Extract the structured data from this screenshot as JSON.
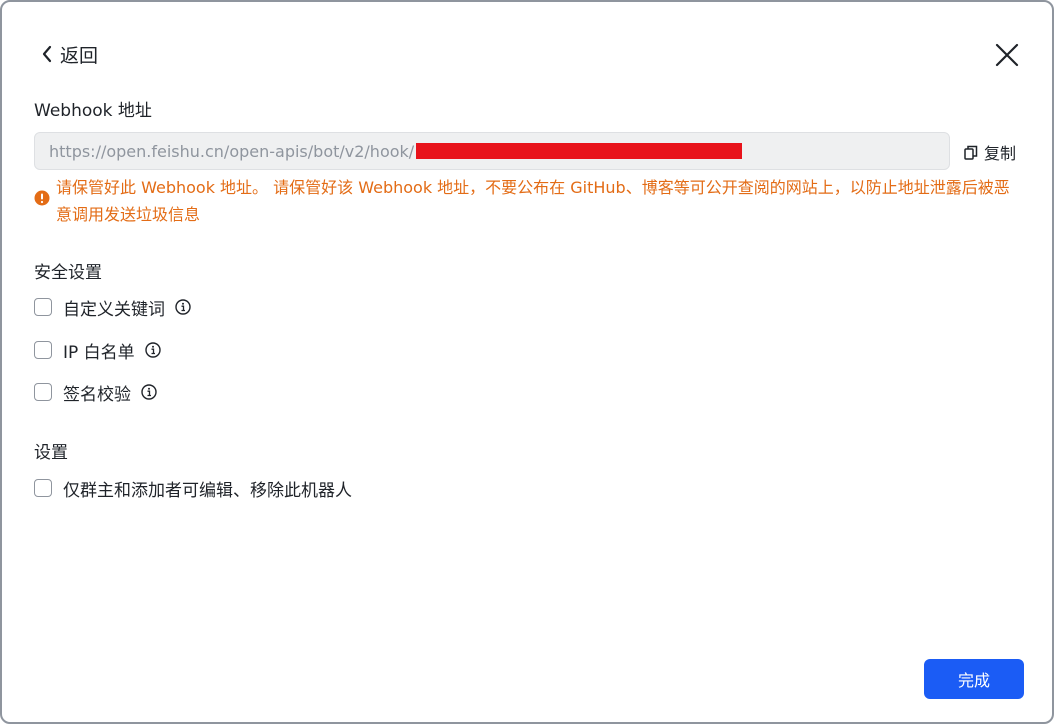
{
  "header": {
    "back_label": "返回"
  },
  "webhook": {
    "label": "Webhook 地址",
    "url_visible": "https://open.feishu.cn/open-apis/bot/v2/hook/",
    "copy_label": "复制",
    "warning": "请保管好此 Webhook 地址。 请保管好该 Webhook 地址，不要公布在 GitHub、博客等可公开查阅的网站上，以防止地址泄露后被恶意调用发送垃圾信息"
  },
  "security": {
    "heading": "安全设置",
    "options": [
      {
        "label": "自定义关键词",
        "checked": false
      },
      {
        "label": "IP 白名单",
        "checked": false
      },
      {
        "label": "签名校验",
        "checked": false
      }
    ]
  },
  "settings": {
    "heading": "设置",
    "options": [
      {
        "label": "仅群主和添加者可编辑、移除此机器人",
        "checked": false
      }
    ]
  },
  "footer": {
    "done_label": "完成"
  },
  "colors": {
    "accent": "#1b5cf5",
    "warning": "#e36c16",
    "redaction": "#e8131b"
  }
}
